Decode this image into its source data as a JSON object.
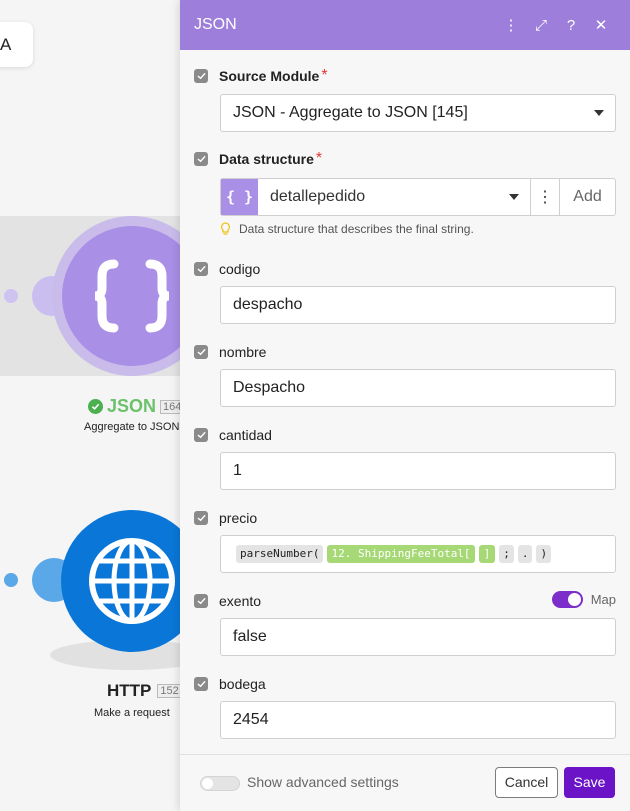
{
  "canvas": {
    "top_chip_text": "A",
    "json_module": {
      "name": "JSON",
      "id": "164",
      "description": "Aggregate to JSON"
    },
    "http_module": {
      "name": "HTTP",
      "id": "152",
      "description": "Make a request"
    }
  },
  "panel": {
    "title": "JSON",
    "header_icons": [
      "more-vertical-icon",
      "expand-icon",
      "help-icon",
      "close-icon"
    ],
    "header_glyphs": {
      "more": "⋮",
      "expand": "⤢",
      "help": "?",
      "close": "✕"
    },
    "source_module": {
      "label": "Source Module",
      "required_mark": "*",
      "value": "JSON - Aggregate to JSON [145]"
    },
    "data_structure": {
      "label": "Data structure",
      "required_mark": "*",
      "icon_text": "{ }",
      "value": "detallepedido",
      "more_glyph": "⋮",
      "add_label": "Add",
      "hint": "Data structure that describes the final string."
    },
    "fields": {
      "codigo": {
        "label": "codigo",
        "value": "despacho"
      },
      "nombre": {
        "label": "nombre",
        "value": "Despacho"
      },
      "cantidad": {
        "label": "cantidad",
        "value": "1"
      },
      "precio": {
        "label": "precio",
        "tokens": [
          "parseNumber(",
          "12. ShippingFeeTotal[",
          "]",
          ";",
          ".",
          ")"
        ]
      },
      "exento": {
        "label": "exento",
        "value": "false",
        "map_label": "Map",
        "map_enabled": true
      },
      "bodega": {
        "label": "bodega",
        "value": "2454"
      }
    },
    "footer": {
      "advanced_label": "Show advanced settings",
      "advanced_enabled": false,
      "cancel_label": "Cancel",
      "save_label": "Save"
    }
  },
  "colors": {
    "accent": "#6a13c7",
    "header": "#9d7fdb",
    "json_module": "#a98fe6",
    "http_module": "#0a77d8",
    "mapped_pill": "#a6d975"
  }
}
